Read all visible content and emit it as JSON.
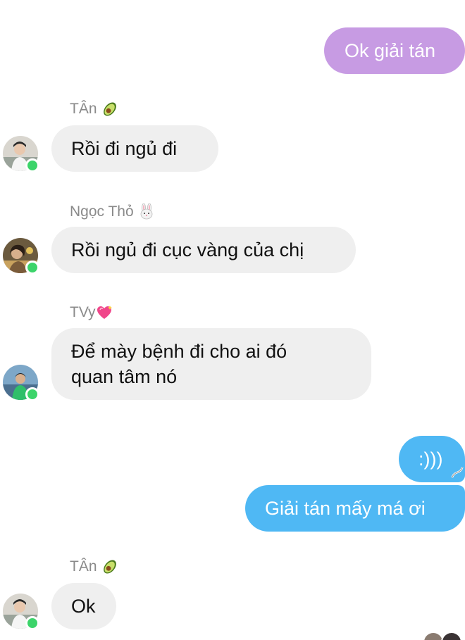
{
  "messages": [
    {
      "id": "m1",
      "from": "me",
      "text": "Ok giải tán"
    },
    {
      "id": "m2",
      "from": "TÂn",
      "text": "Rồi đi ngủ đi"
    },
    {
      "id": "m3",
      "from": "Ngọc Thỏ",
      "text": "Rồi ngủ đi cục vàng của chị"
    },
    {
      "id": "m4",
      "from": "TVy",
      "line1": "Để mày bệnh đi cho ai đó",
      "line2": "quan tâm nó"
    },
    {
      "id": "m5",
      "from": "me",
      "text": ":)))"
    },
    {
      "id": "m6",
      "from": "me",
      "text": "Giải tán mấy má ơi"
    },
    {
      "id": "m7",
      "from": "TÂn",
      "text": "Ok"
    }
  ],
  "senders": {
    "tan": {
      "name": "TÂn",
      "emoji": "avocado-icon"
    },
    "ngoc_tho": {
      "name": "Ngọc Thỏ",
      "emoji": "rabbit-face-icon"
    },
    "tvy": {
      "name": "TVy",
      "emoji": "sparkling-heart-icon"
    }
  },
  "colors": {
    "outgoing_purple": "#c79be3",
    "outgoing_blue": "#4fb8f4",
    "incoming_bubble": "#efefef",
    "online_dot": "#3cd46a",
    "sender_name": "#8a8a8a"
  }
}
